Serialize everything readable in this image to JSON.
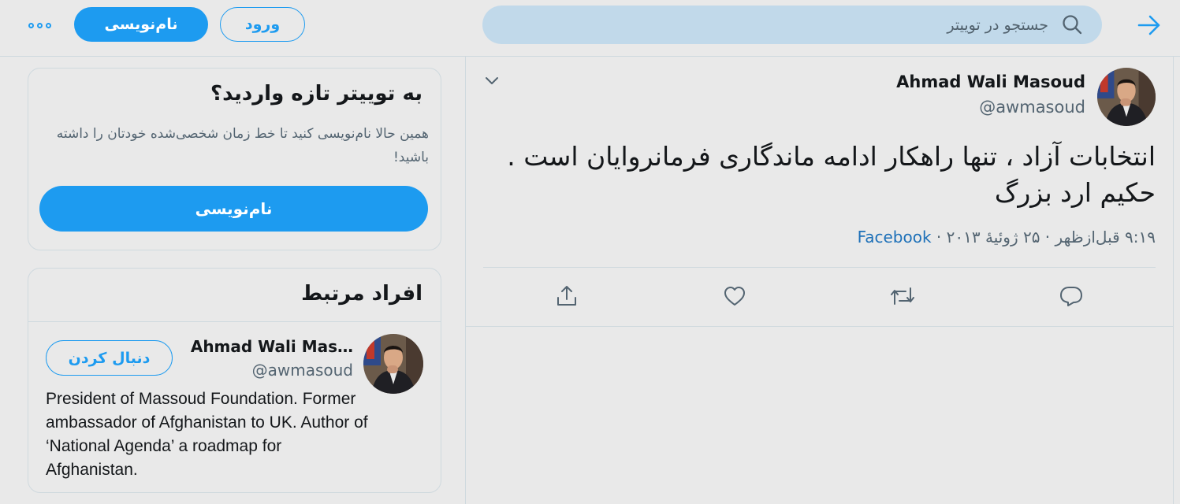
{
  "topbar": {
    "search_placeholder": "جستجو در توییتر",
    "login_label": "ورود",
    "signup_label": "نام‌نویسی"
  },
  "new_card": {
    "title": "به توییتر تازه واردید؟",
    "subtitle": "همین حالا نام‌نویسی کنید تا خط زمان شخصی‌شده خودتان را داشته باشید!",
    "button_label": "نام‌نویسی"
  },
  "related_card": {
    "title": "افراد مرتبط",
    "user": {
      "name": "Ahmad Wali Mas…",
      "handle": "@awmasoud",
      "follow_label": "دنبال کردن",
      "bio": "President of Massoud Foundation. Former ambassador of Afghanistan to UK. Author of ‘National Agenda’ a roadmap for Afghanistan."
    }
  },
  "tweet": {
    "name": "Ahmad Wali Masoud",
    "handle": "@awmasoud",
    "text": "انتخابات آزاد ، تنها راهکار ادامه ماندگاری فرمانروایان است . حکیم ارد بزرگ",
    "time": "۹:۱۹ قبل‌ازظهر",
    "date": "۲۵ ژوئیهٔ ۲۰۱۳",
    "source": "Facebook"
  },
  "colors": {
    "accent": "#1d9bf0",
    "background": "#e9e9e9",
    "search_bg": "#c1d9ea",
    "muted_text": "#536471"
  },
  "icons": [
    "back-arrow-icon",
    "search-icon",
    "more-icon",
    "chevron-down-icon",
    "reply-icon",
    "retweet-icon",
    "like-icon",
    "share-icon"
  ]
}
